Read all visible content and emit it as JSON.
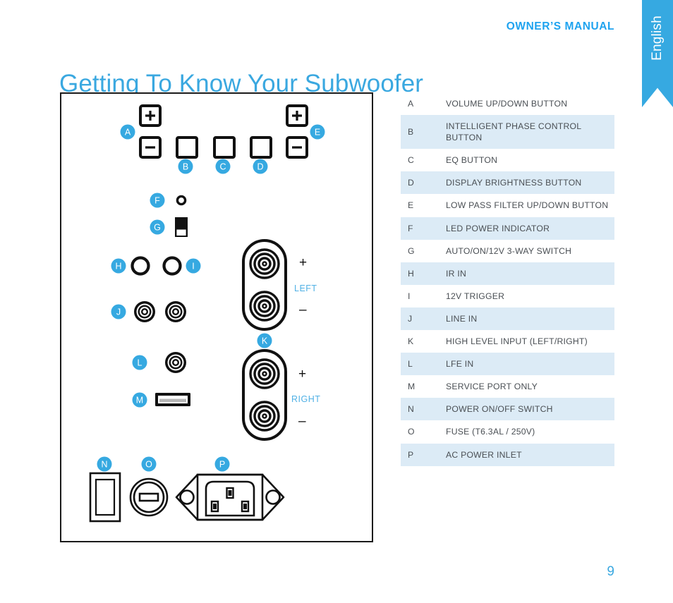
{
  "header": {
    "owners_manual": "OWNER’S MANUAL",
    "language_tab": "English",
    "title": "Getting To Know Your Subwoofer"
  },
  "footer": {
    "page_number": "9"
  },
  "colors": {
    "accent_blue": "#36a9e1",
    "title_blue": "#3aa8e0",
    "row_stripe": "#dcebf6",
    "panel_line": "#1b1b1b",
    "text": "#4a4f54"
  },
  "legend": {
    "rows": [
      {
        "key": "A",
        "desc": "VOLUME UP/DOWN BUTTON"
      },
      {
        "key": "B",
        "desc": "INTELLIGENT PHASE CONTROL BUTTON"
      },
      {
        "key": "C",
        "desc": "EQ BUTTON"
      },
      {
        "key": "D",
        "desc": "DISPLAY BRIGHTNESS BUTTON"
      },
      {
        "key": "E",
        "desc": "LOW PASS FILTER UP/DOWN BUTTON"
      },
      {
        "key": "F",
        "desc": "LED POWER INDICATOR"
      },
      {
        "key": "G",
        "desc": "AUTO/ON/12V 3-WAY SWITCH"
      },
      {
        "key": "H",
        "desc": "IR IN"
      },
      {
        "key": "I",
        "desc": "12V TRIGGER"
      },
      {
        "key": "J",
        "desc": "LINE IN"
      },
      {
        "key": "K",
        "desc": "HIGH LEVEL INPUT (LEFT/RIGHT)"
      },
      {
        "key": "L",
        "desc": "LFE IN"
      },
      {
        "key": "M",
        "desc": "SERVICE PORT ONLY"
      },
      {
        "key": "N",
        "desc": "POWER ON/OFF SWITCH"
      },
      {
        "key": "O",
        "desc": "FUSE (T6.3AL / 250V)"
      },
      {
        "key": "P",
        "desc": "AC POWER INLET"
      }
    ]
  },
  "panel": {
    "callouts": {
      "a": "A",
      "b": "B",
      "c": "C",
      "d": "D",
      "e": "E",
      "f": "F",
      "g": "G",
      "h": "H",
      "i": "I",
      "j": "J",
      "k": "K",
      "l": "L",
      "m": "M",
      "n": "N",
      "o": "O",
      "p": "P"
    },
    "button_symbols": {
      "volume_up": "+",
      "volume_down": "–",
      "lpf_up": "+",
      "lpf_down": "–"
    },
    "terminals": {
      "left_label": "LEFT",
      "left_plus": "+",
      "left_minus": "–",
      "right_label": "RIGHT",
      "right_plus": "+",
      "right_minus": "–"
    }
  }
}
